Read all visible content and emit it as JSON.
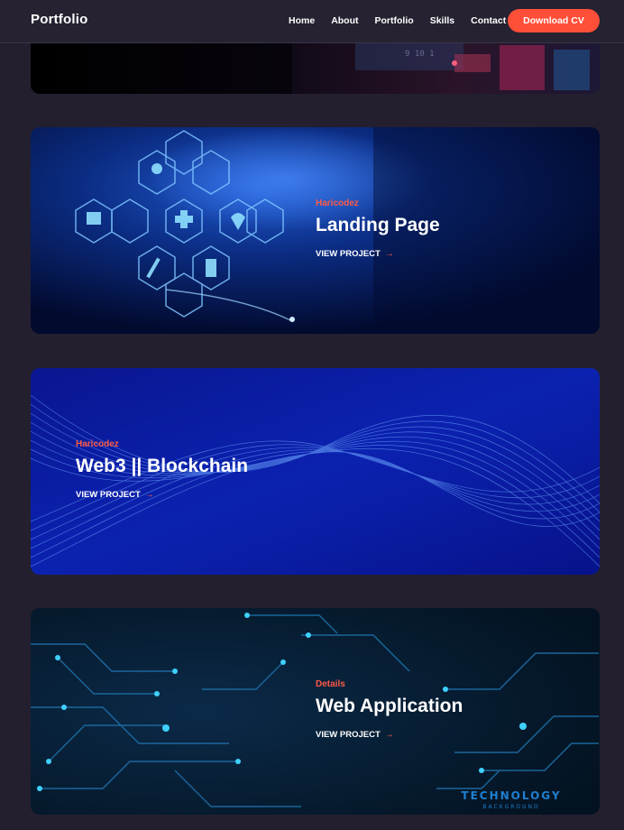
{
  "nav": {
    "brand": "Portfolio",
    "links": [
      "Home",
      "About",
      "Portfolio",
      "Skills",
      "Contact"
    ],
    "cta_label": "Download CV"
  },
  "projects": [
    {
      "tag": "Haricodez",
      "title": "Landing Page",
      "link_label": "VIEW PROJECT",
      "arrow": "→"
    },
    {
      "tag": "Haricodez",
      "title": "Web3 || Blockchain",
      "link_label": "VIEW PROJECT",
      "arrow": "→"
    },
    {
      "tag": "Details",
      "title": "Web Application",
      "link_label": "VIEW PROJECT",
      "arrow": "→"
    }
  ],
  "top_card_art_text": "9 10 1",
  "tech_art": {
    "line1": "TECHNOLOGY",
    "line2": "BACKGROUND"
  },
  "colors": {
    "accent": "#ff4f38",
    "background": "#231f2f"
  }
}
